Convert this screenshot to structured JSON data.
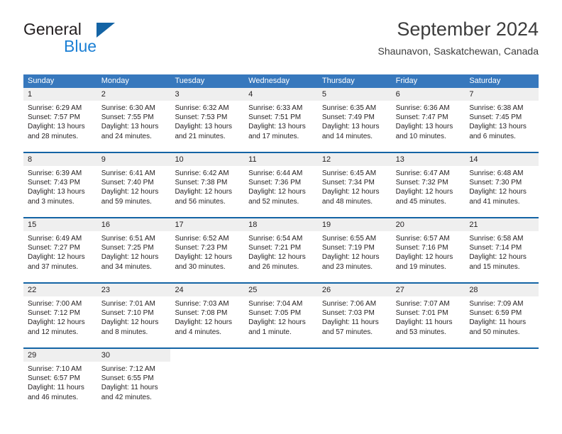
{
  "brand": {
    "word1": "General",
    "word2": "Blue",
    "triangle_icon": "brand-triangle-icon",
    "accent_color": "#1464a5",
    "blue_text_color": "#1b7fd4"
  },
  "header": {
    "title": "September 2024",
    "subtitle": "Shaunavon, Saskatchewan, Canada"
  },
  "calendar": {
    "header_bg": "#3778bd",
    "row_rule_color": "#1464a5",
    "day_band_bg": "#efefef",
    "weekdays": [
      "Sunday",
      "Monday",
      "Tuesday",
      "Wednesday",
      "Thursday",
      "Friday",
      "Saturday"
    ],
    "weeks": [
      [
        {
          "date": "1",
          "sunrise": "Sunrise: 6:29 AM",
          "sunset": "Sunset: 7:57 PM",
          "daylight_line1": "Daylight: 13 hours",
          "daylight_line2": "and 28 minutes."
        },
        {
          "date": "2",
          "sunrise": "Sunrise: 6:30 AM",
          "sunset": "Sunset: 7:55 PM",
          "daylight_line1": "Daylight: 13 hours",
          "daylight_line2": "and 24 minutes."
        },
        {
          "date": "3",
          "sunrise": "Sunrise: 6:32 AM",
          "sunset": "Sunset: 7:53 PM",
          "daylight_line1": "Daylight: 13 hours",
          "daylight_line2": "and 21 minutes."
        },
        {
          "date": "4",
          "sunrise": "Sunrise: 6:33 AM",
          "sunset": "Sunset: 7:51 PM",
          "daylight_line1": "Daylight: 13 hours",
          "daylight_line2": "and 17 minutes."
        },
        {
          "date": "5",
          "sunrise": "Sunrise: 6:35 AM",
          "sunset": "Sunset: 7:49 PM",
          "daylight_line1": "Daylight: 13 hours",
          "daylight_line2": "and 14 minutes."
        },
        {
          "date": "6",
          "sunrise": "Sunrise: 6:36 AM",
          "sunset": "Sunset: 7:47 PM",
          "daylight_line1": "Daylight: 13 hours",
          "daylight_line2": "and 10 minutes."
        },
        {
          "date": "7",
          "sunrise": "Sunrise: 6:38 AM",
          "sunset": "Sunset: 7:45 PM",
          "daylight_line1": "Daylight: 13 hours",
          "daylight_line2": "and 6 minutes."
        }
      ],
      [
        {
          "date": "8",
          "sunrise": "Sunrise: 6:39 AM",
          "sunset": "Sunset: 7:43 PM",
          "daylight_line1": "Daylight: 13 hours",
          "daylight_line2": "and 3 minutes."
        },
        {
          "date": "9",
          "sunrise": "Sunrise: 6:41 AM",
          "sunset": "Sunset: 7:40 PM",
          "daylight_line1": "Daylight: 12 hours",
          "daylight_line2": "and 59 minutes."
        },
        {
          "date": "10",
          "sunrise": "Sunrise: 6:42 AM",
          "sunset": "Sunset: 7:38 PM",
          "daylight_line1": "Daylight: 12 hours",
          "daylight_line2": "and 56 minutes."
        },
        {
          "date": "11",
          "sunrise": "Sunrise: 6:44 AM",
          "sunset": "Sunset: 7:36 PM",
          "daylight_line1": "Daylight: 12 hours",
          "daylight_line2": "and 52 minutes."
        },
        {
          "date": "12",
          "sunrise": "Sunrise: 6:45 AM",
          "sunset": "Sunset: 7:34 PM",
          "daylight_line1": "Daylight: 12 hours",
          "daylight_line2": "and 48 minutes."
        },
        {
          "date": "13",
          "sunrise": "Sunrise: 6:47 AM",
          "sunset": "Sunset: 7:32 PM",
          "daylight_line1": "Daylight: 12 hours",
          "daylight_line2": "and 45 minutes."
        },
        {
          "date": "14",
          "sunrise": "Sunrise: 6:48 AM",
          "sunset": "Sunset: 7:30 PM",
          "daylight_line1": "Daylight: 12 hours",
          "daylight_line2": "and 41 minutes."
        }
      ],
      [
        {
          "date": "15",
          "sunrise": "Sunrise: 6:49 AM",
          "sunset": "Sunset: 7:27 PM",
          "daylight_line1": "Daylight: 12 hours",
          "daylight_line2": "and 37 minutes."
        },
        {
          "date": "16",
          "sunrise": "Sunrise: 6:51 AM",
          "sunset": "Sunset: 7:25 PM",
          "daylight_line1": "Daylight: 12 hours",
          "daylight_line2": "and 34 minutes."
        },
        {
          "date": "17",
          "sunrise": "Sunrise: 6:52 AM",
          "sunset": "Sunset: 7:23 PM",
          "daylight_line1": "Daylight: 12 hours",
          "daylight_line2": "and 30 minutes."
        },
        {
          "date": "18",
          "sunrise": "Sunrise: 6:54 AM",
          "sunset": "Sunset: 7:21 PM",
          "daylight_line1": "Daylight: 12 hours",
          "daylight_line2": "and 26 minutes."
        },
        {
          "date": "19",
          "sunrise": "Sunrise: 6:55 AM",
          "sunset": "Sunset: 7:19 PM",
          "daylight_line1": "Daylight: 12 hours",
          "daylight_line2": "and 23 minutes."
        },
        {
          "date": "20",
          "sunrise": "Sunrise: 6:57 AM",
          "sunset": "Sunset: 7:16 PM",
          "daylight_line1": "Daylight: 12 hours",
          "daylight_line2": "and 19 minutes."
        },
        {
          "date": "21",
          "sunrise": "Sunrise: 6:58 AM",
          "sunset": "Sunset: 7:14 PM",
          "daylight_line1": "Daylight: 12 hours",
          "daylight_line2": "and 15 minutes."
        }
      ],
      [
        {
          "date": "22",
          "sunrise": "Sunrise: 7:00 AM",
          "sunset": "Sunset: 7:12 PM",
          "daylight_line1": "Daylight: 12 hours",
          "daylight_line2": "and 12 minutes."
        },
        {
          "date": "23",
          "sunrise": "Sunrise: 7:01 AM",
          "sunset": "Sunset: 7:10 PM",
          "daylight_line1": "Daylight: 12 hours",
          "daylight_line2": "and 8 minutes."
        },
        {
          "date": "24",
          "sunrise": "Sunrise: 7:03 AM",
          "sunset": "Sunset: 7:08 PM",
          "daylight_line1": "Daylight: 12 hours",
          "daylight_line2": "and 4 minutes."
        },
        {
          "date": "25",
          "sunrise": "Sunrise: 7:04 AM",
          "sunset": "Sunset: 7:05 PM",
          "daylight_line1": "Daylight: 12 hours",
          "daylight_line2": "and 1 minute."
        },
        {
          "date": "26",
          "sunrise": "Sunrise: 7:06 AM",
          "sunset": "Sunset: 7:03 PM",
          "daylight_line1": "Daylight: 11 hours",
          "daylight_line2": "and 57 minutes."
        },
        {
          "date": "27",
          "sunrise": "Sunrise: 7:07 AM",
          "sunset": "Sunset: 7:01 PM",
          "daylight_line1": "Daylight: 11 hours",
          "daylight_line2": "and 53 minutes."
        },
        {
          "date": "28",
          "sunrise": "Sunrise: 7:09 AM",
          "sunset": "Sunset: 6:59 PM",
          "daylight_line1": "Daylight: 11 hours",
          "daylight_line2": "and 50 minutes."
        }
      ],
      [
        {
          "date": "29",
          "sunrise": "Sunrise: 7:10 AM",
          "sunset": "Sunset: 6:57 PM",
          "daylight_line1": "Daylight: 11 hours",
          "daylight_line2": "and 46 minutes."
        },
        {
          "date": "30",
          "sunrise": "Sunrise: 7:12 AM",
          "sunset": "Sunset: 6:55 PM",
          "daylight_line1": "Daylight: 11 hours",
          "daylight_line2": "and 42 minutes."
        },
        {
          "date": "",
          "sunrise": "",
          "sunset": "",
          "daylight_line1": "",
          "daylight_line2": ""
        },
        {
          "date": "",
          "sunrise": "",
          "sunset": "",
          "daylight_line1": "",
          "daylight_line2": ""
        },
        {
          "date": "",
          "sunrise": "",
          "sunset": "",
          "daylight_line1": "",
          "daylight_line2": ""
        },
        {
          "date": "",
          "sunrise": "",
          "sunset": "",
          "daylight_line1": "",
          "daylight_line2": ""
        },
        {
          "date": "",
          "sunrise": "",
          "sunset": "",
          "daylight_line1": "",
          "daylight_line2": ""
        }
      ]
    ]
  }
}
